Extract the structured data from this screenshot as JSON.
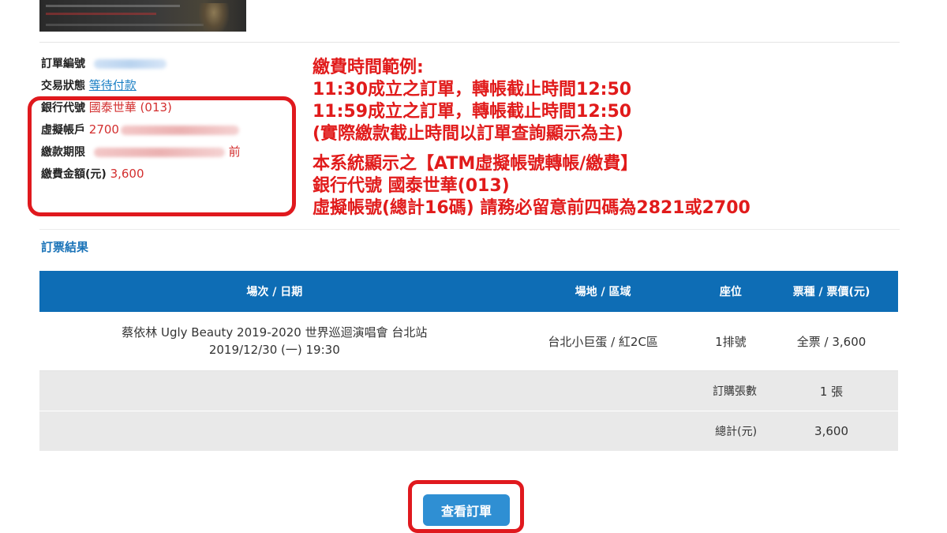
{
  "order_info": {
    "order_no_label": "訂單編號",
    "status_label": "交易狀態",
    "status_value": "等待付款",
    "bank_code_label": "銀行代號",
    "bank_code_value": "國泰世華 (013)",
    "virtual_account_label": "虛擬帳戶",
    "virtual_account_prefix": "2700",
    "deadline_label": "繳款期限",
    "deadline_suffix": "前",
    "amount_label": "繳費金額(元)",
    "amount_value": "3,600"
  },
  "annotation": {
    "line1": "繳費時間範例:",
    "line2": "11:30成立之訂單，轉帳截止時間12:50",
    "line3": "11:59成立之訂單，轉帳截止時間12:50",
    "line4": "(實際繳款截止時間以訂單查詢顯示為主)",
    "line5": "本系統顯示之【ATM虛擬帳號轉帳/繳費】",
    "line6": "銀行代號 國泰世華(013)",
    "line7": "虛擬帳號(總計16碼) 請務必留意前四碼為2821或2700"
  },
  "result_title": "訂票結果",
  "table": {
    "headers": [
      "場次 / 日期",
      "場地 / 區域",
      "座位",
      "票種 / 票價(元)"
    ],
    "row": {
      "show_line1": "蔡依林 Ugly Beauty 2019-2020 世界巡迴演唱會 台北站",
      "show_line2": "2019/12/30 (一) 19:30",
      "venue": "台北小巨蛋 / 紅2C區",
      "seat": "1排號",
      "ticket": "全票 / 3,600"
    },
    "qty_label": "訂購張數",
    "qty_value": "1 張",
    "total_label": "總計(元)",
    "total_value": "3,600"
  },
  "view_order_button": "查看訂單",
  "colors": {
    "accent": "#0e6db5",
    "highlight": "#e0191e",
    "link": "#1a7fc4"
  }
}
